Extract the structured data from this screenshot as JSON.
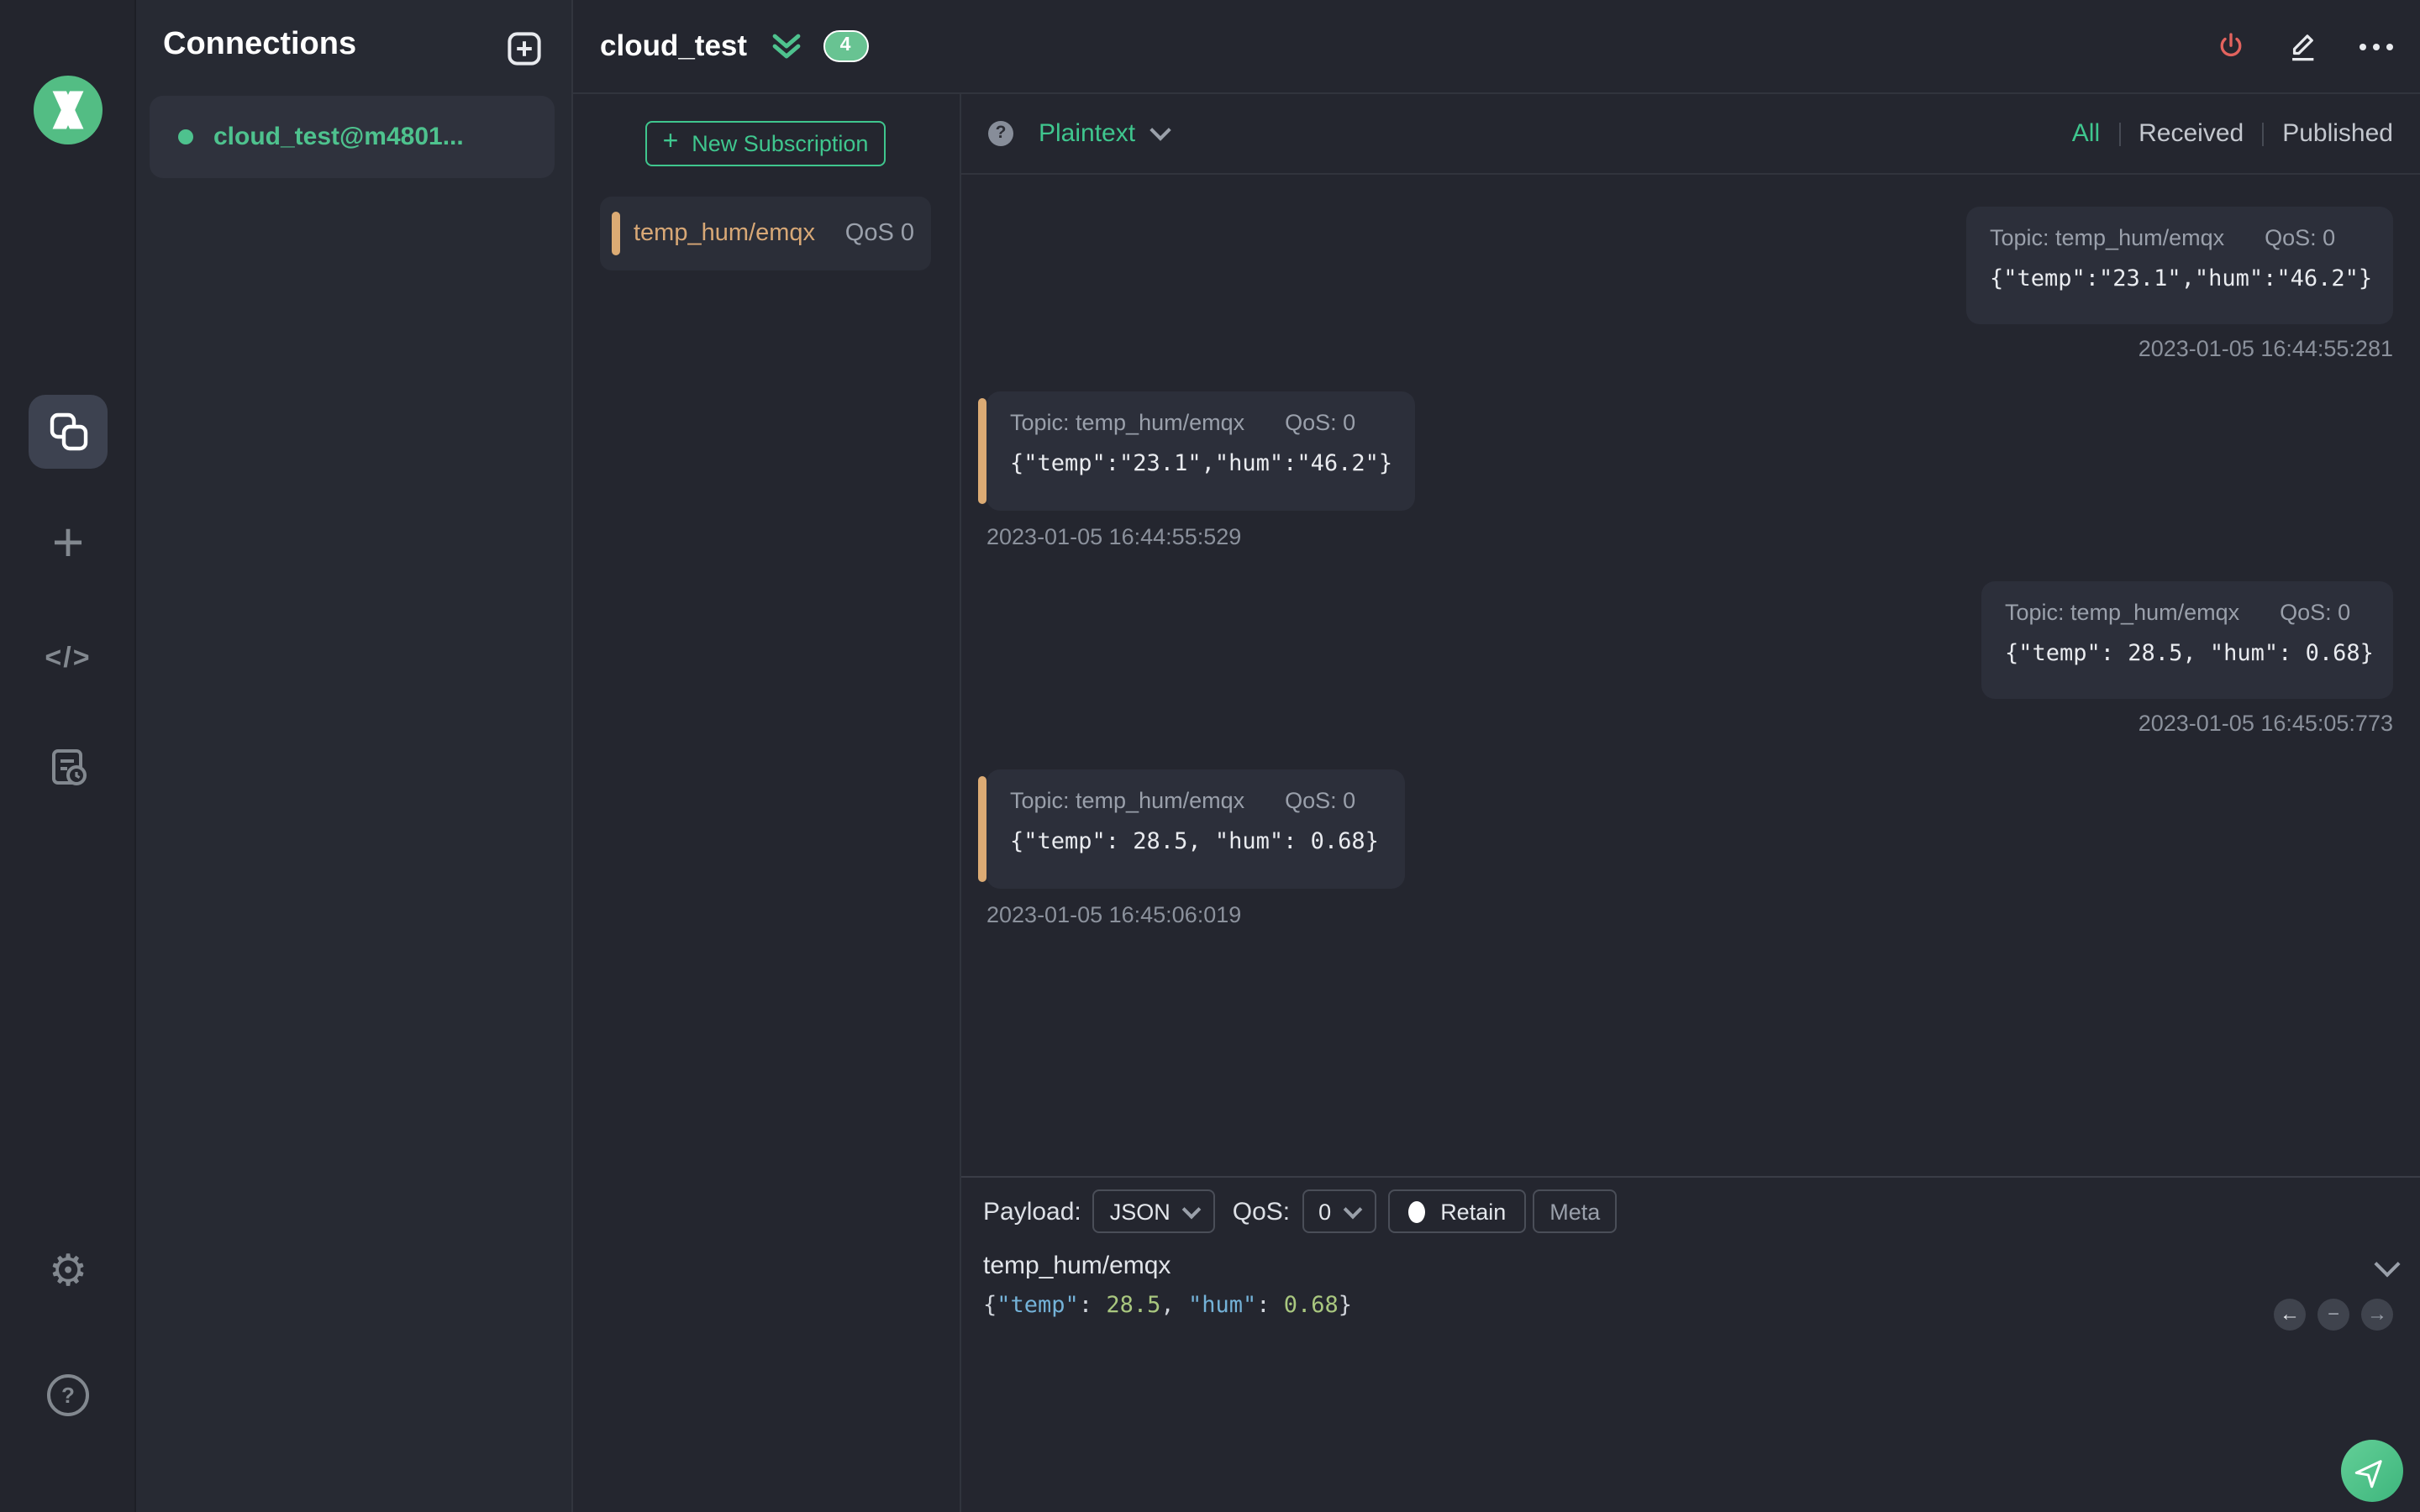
{
  "colors": {
    "accent_green": "#3fc68e",
    "logo_green": "#53bd84",
    "orange_accent": "#dcab74",
    "power_red": "#e2635e",
    "bubble_bg": "#2c2f3a",
    "panel_bg": "#272a33",
    "main_bg": "#24262f"
  },
  "sidebar": {
    "icons": [
      "connections-icon",
      "new-connection-icon",
      "script-icon",
      "log-icon",
      "settings-icon",
      "help-icon"
    ],
    "new_glyph": "+",
    "code_glyph": "</>",
    "gear_glyph": "⚙",
    "help_glyph": "?"
  },
  "connections": {
    "title": "Connections",
    "item": {
      "name": "cloud_test@m4801..."
    }
  },
  "header": {
    "title": "cloud_test",
    "badge": "4"
  },
  "subscriptions": {
    "new_button_plus": "+",
    "new_button": "New Subscription",
    "item": {
      "topic": "temp_hum/emqx",
      "qos": "QoS 0"
    }
  },
  "messages": {
    "help_glyph": "?",
    "format": "Plaintext",
    "filters": {
      "all": "All",
      "received": "Received",
      "published": "Published"
    },
    "items": [
      {
        "side": "published",
        "topic": "Topic: temp_hum/emqx",
        "qos": "QoS: 0",
        "payload": "{\"temp\":\"23.1\",\"hum\":\"46.2\"}",
        "time": "2023-01-05 16:44:55:281"
      },
      {
        "side": "received",
        "topic": "Topic: temp_hum/emqx",
        "qos": "QoS: 0",
        "payload": "{\"temp\":\"23.1\",\"hum\":\"46.2\"}",
        "time": "2023-01-05 16:44:55:529"
      },
      {
        "side": "published",
        "topic": "Topic: temp_hum/emqx",
        "qos": "QoS: 0",
        "payload": "{\"temp\": 28.5, \"hum\": 0.68}",
        "time": "2023-01-05 16:45:05:773"
      },
      {
        "side": "received",
        "topic": "Topic: temp_hum/emqx",
        "qos": "QoS: 0",
        "payload": "{\"temp\": 28.5, \"hum\": 0.68}",
        "time": "2023-01-05 16:45:06:019"
      }
    ]
  },
  "publish": {
    "payload_label": "Payload:",
    "payload_type": "JSON",
    "qos_label": "QoS:",
    "qos_value": "0",
    "retain_label": "Retain",
    "meta_label": "Meta",
    "topic": "temp_hum/emqx",
    "editor": {
      "t1": "{",
      "t2": "\"temp\"",
      "t3": ": ",
      "t4": "28.5",
      "t5": ", ",
      "t6": "\"hum\"",
      "t7": ": ",
      "t8": "0.68",
      "t9": "}"
    },
    "nav": {
      "prev": "←",
      "remove": "−",
      "next": "→"
    }
  }
}
